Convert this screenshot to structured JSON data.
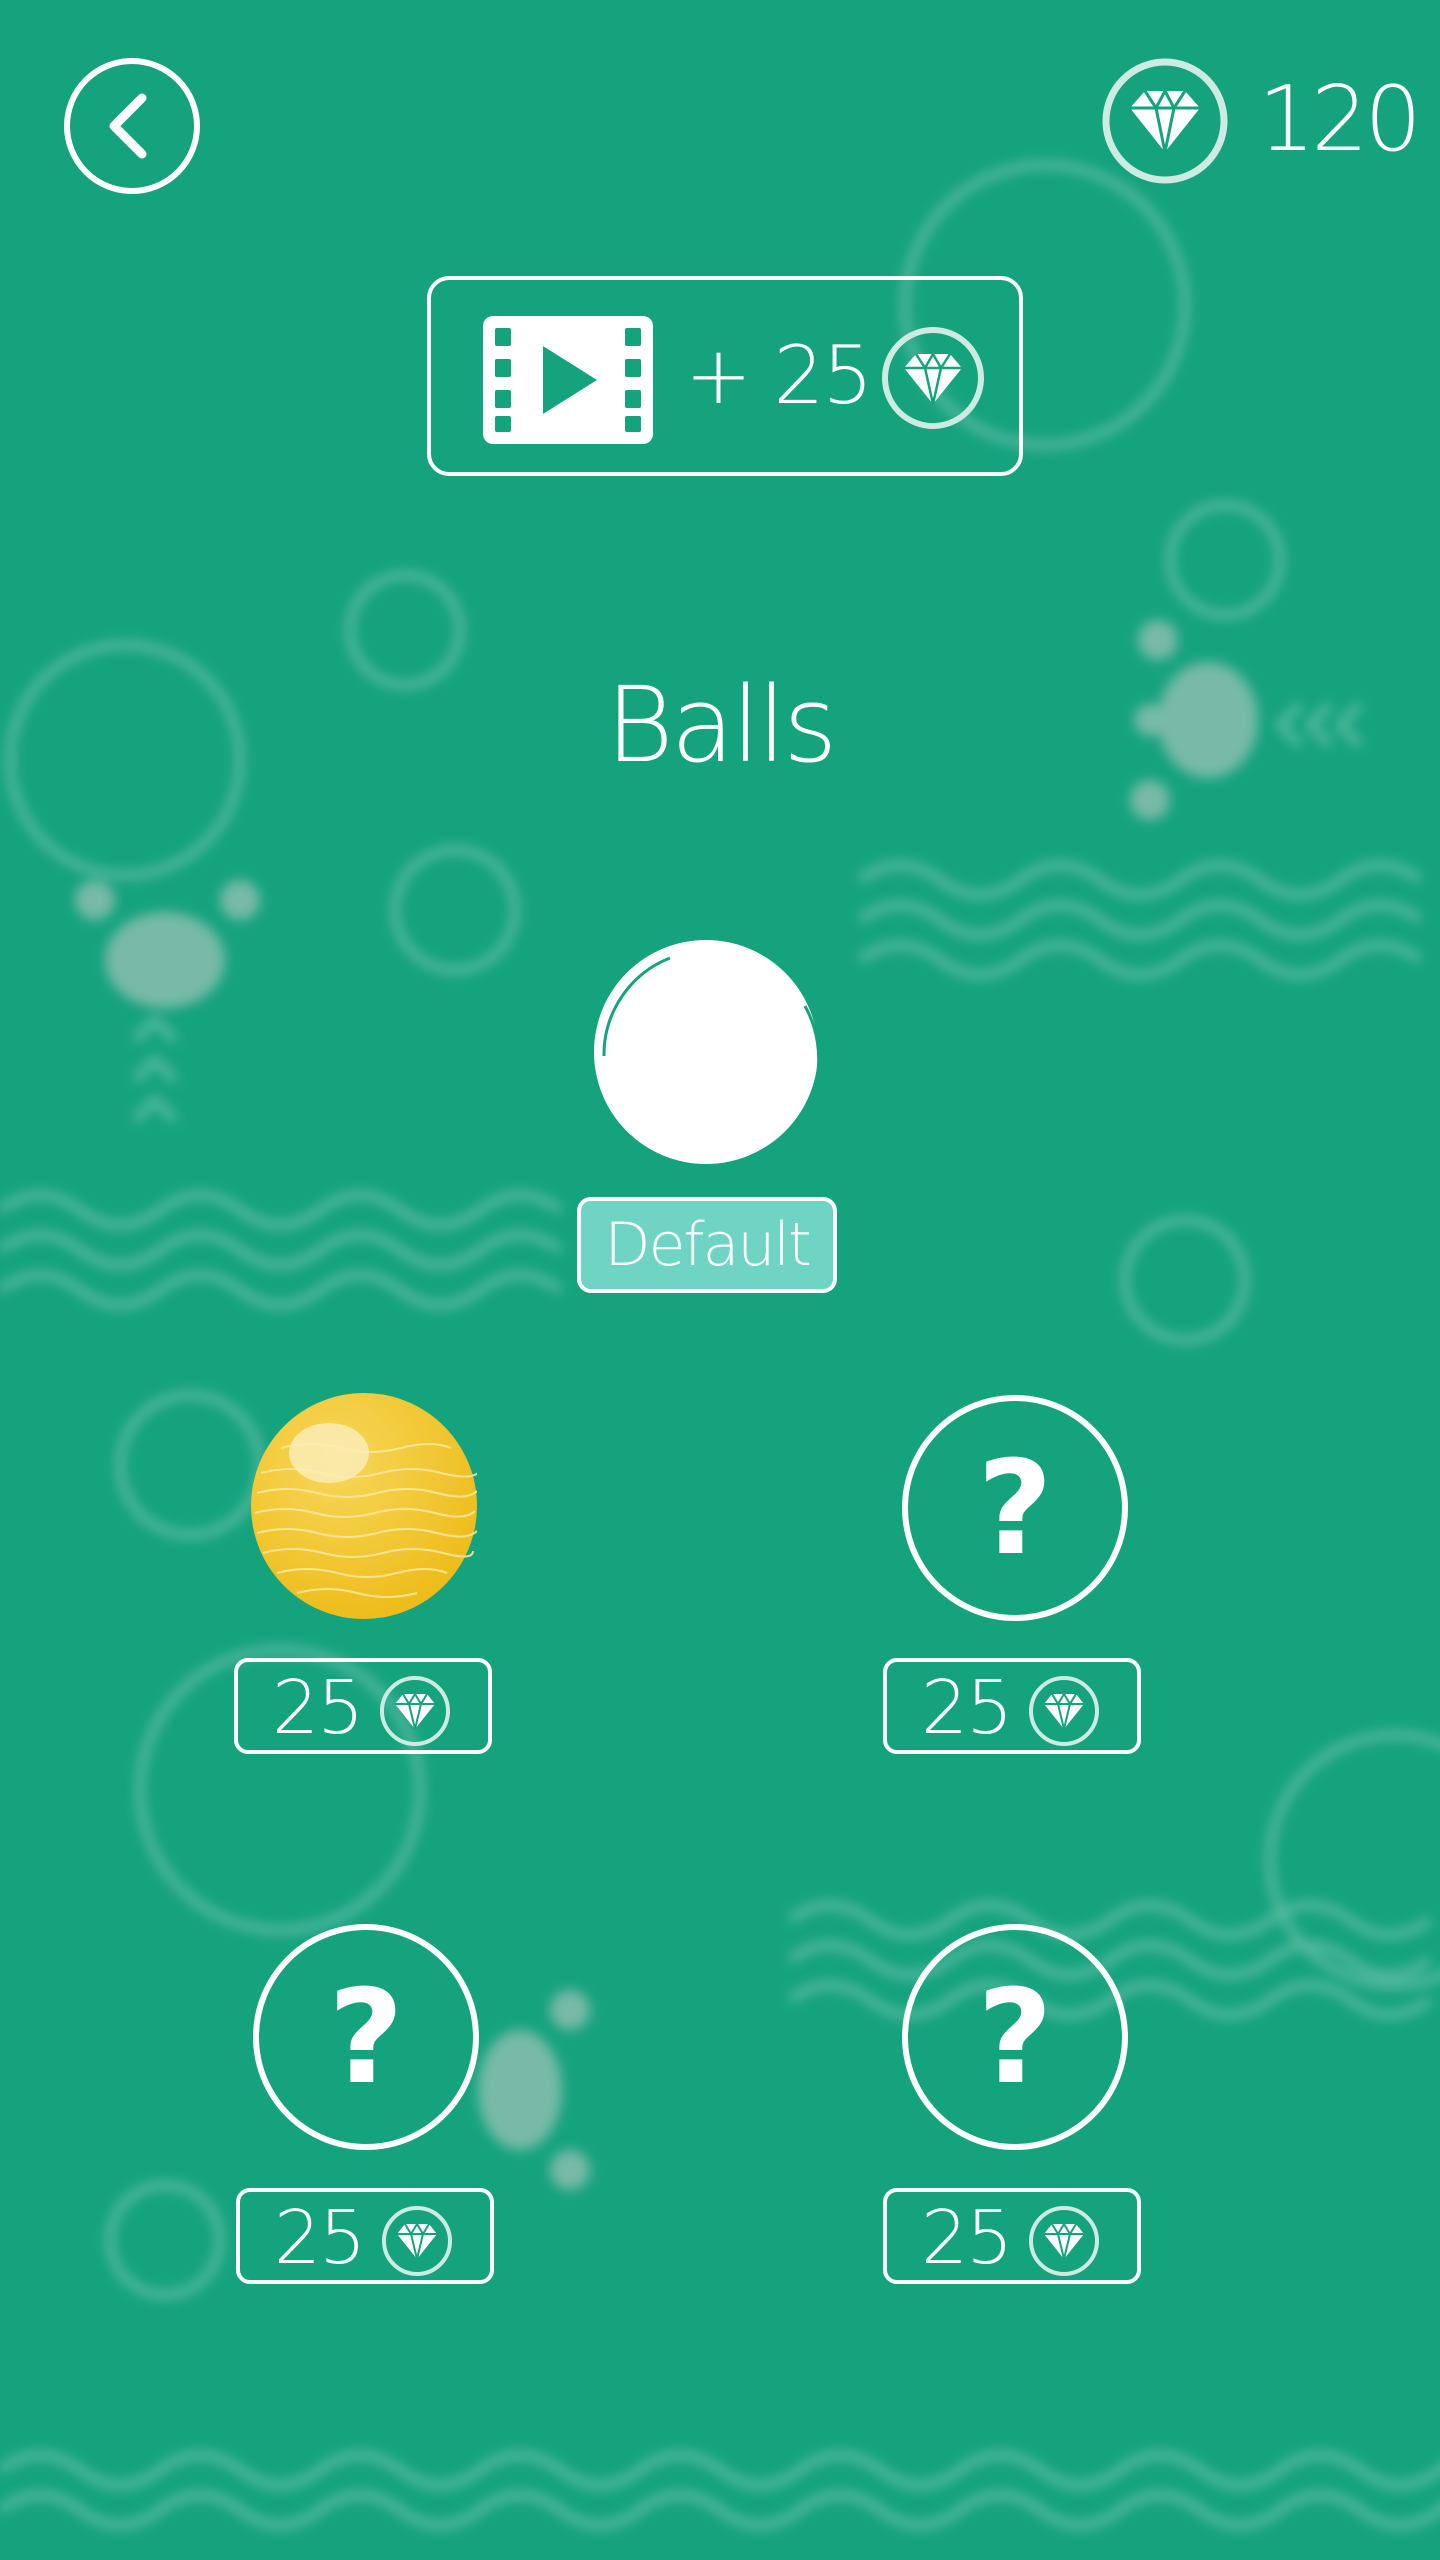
{
  "header": {
    "gem_count": "120",
    "back_icon": "chevron-left-icon",
    "gem_icon": "diamond-icon"
  },
  "video_reward": {
    "label": "+ 25",
    "video_icon": "film-play-icon",
    "gem_icon": "diamond-icon"
  },
  "page_title": "Balls",
  "default_ball": {
    "label": "Default"
  },
  "shop_items": [
    {
      "ball": "yellow-textured-ball",
      "price": "25",
      "locked": false
    },
    {
      "ball": "unknown",
      "price": "25",
      "locked": true
    },
    {
      "ball": "unknown",
      "price": "25",
      "locked": true
    },
    {
      "ball": "unknown",
      "price": "25",
      "locked": true
    }
  ],
  "lock_symbol": "?",
  "colors": {
    "background": "#15a37e",
    "foreground": "#ffffff",
    "selected_badge": "#6fd4c3",
    "ball_yellow": "#f1c829"
  }
}
